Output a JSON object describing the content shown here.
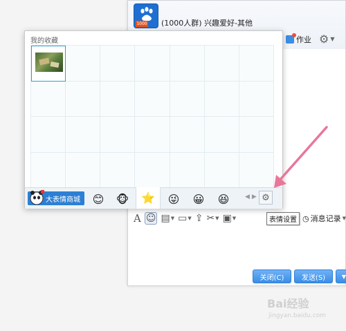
{
  "chat": {
    "group_badge": "1000",
    "title": "(1000人群) 兴趣爱好-其他",
    "homework_label": "作业",
    "tooltip": "表情设置",
    "history_label": "消息记录",
    "close_label": "关闭(C)",
    "send_label": "发送(S)"
  },
  "panel": {
    "title": "我的收藏",
    "shop_label": "大表情商城",
    "tabs": [
      {
        "icon": "smile-emoji-icon",
        "glyph": "😊"
      },
      {
        "icon": "monkey-emoji-icon",
        "glyph": "🐵"
      },
      {
        "icon": "favorites-star-icon",
        "glyph": "⭐"
      },
      {
        "icon": "cartoon-emoji-icon",
        "glyph": "😜"
      },
      {
        "icon": "face-emoji-icon",
        "glyph": "😀"
      },
      {
        "icon": "cartoon-emoji-icon",
        "glyph": "😆"
      }
    ]
  },
  "watermark": {
    "main": "Bai经验",
    "sub": "jingyan.baidu.com"
  },
  "colors": {
    "accent": "#2d7fd3",
    "button": "#3a8ee6",
    "annotation_arrow": "#e8779a",
    "grid_line": "#e3ecef"
  }
}
